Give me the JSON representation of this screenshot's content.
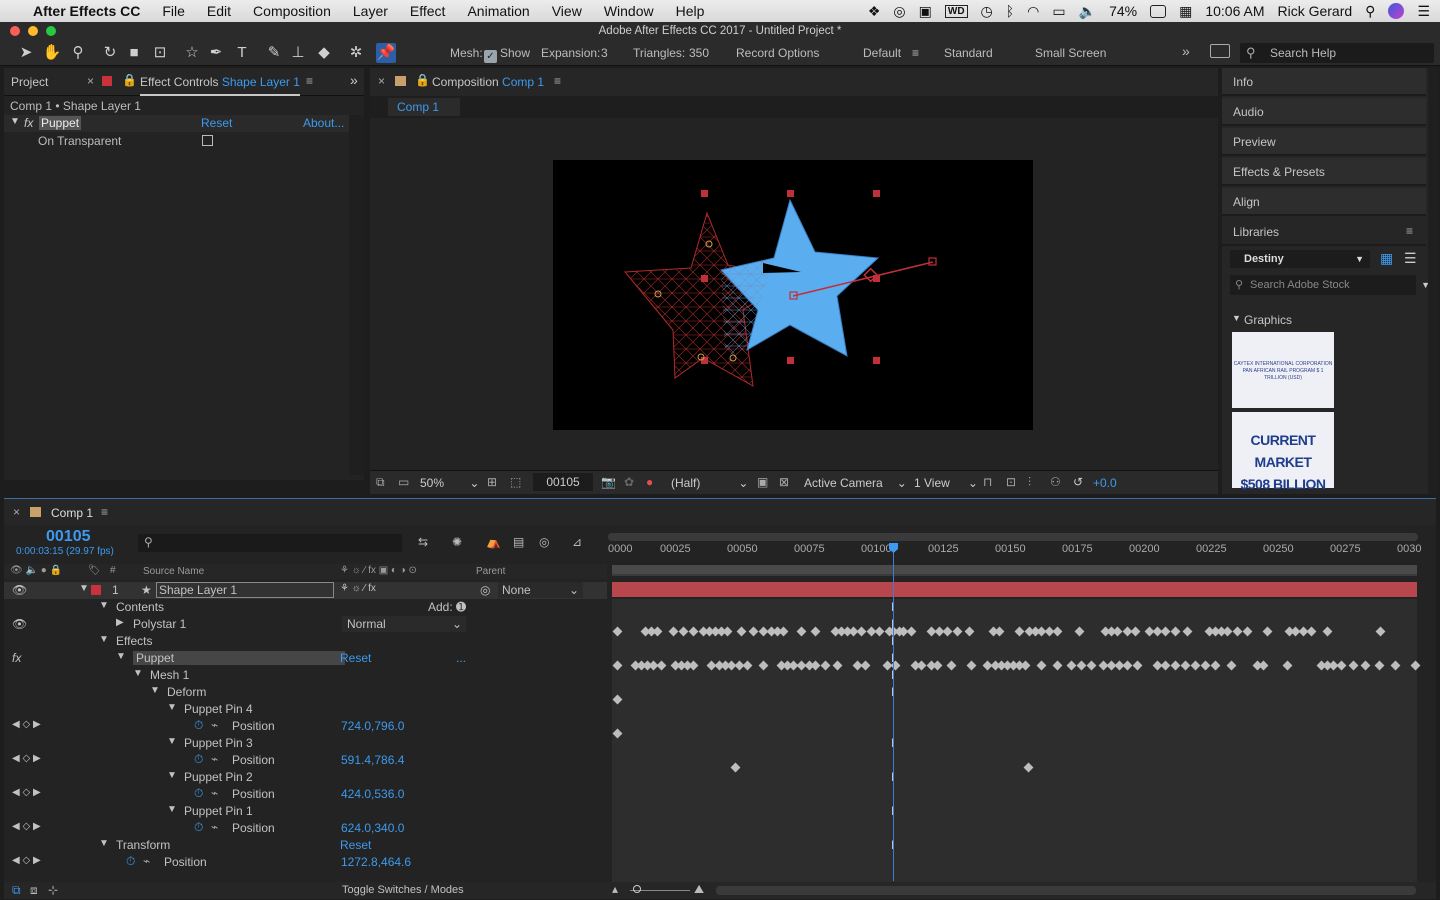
{
  "menubar": {
    "app_name": "After Effects CC",
    "items": [
      "File",
      "Edit",
      "Composition",
      "Layer",
      "Effect",
      "Animation",
      "View",
      "Window",
      "Help"
    ],
    "battery": "74%",
    "clock": "10:06 AM",
    "user": "Rick Gerard"
  },
  "window": {
    "title": "Adobe After Effects CC 2017 - Untitled Project *"
  },
  "toolbar": {
    "mesh_label": "Mesh:",
    "show_label": "Show",
    "expansion_label": "Expansion:",
    "expansion_value": "3",
    "triangles_label": "Triangles:",
    "triangles_value": "350",
    "record_options": "Record Options",
    "workspaces": [
      "Default",
      "Standard",
      "Small Screen"
    ],
    "search_help": "Search Help"
  },
  "effect_controls": {
    "tab_project": "Project",
    "tab_prefix": "Effect Controls",
    "tab_layer": "Shape Layer 1",
    "breadcrumb": "Comp 1 • Shape Layer 1",
    "effect_name": "Puppet",
    "reset": "Reset",
    "about": "About...",
    "on_transparent": "On Transparent"
  },
  "composition": {
    "tab_prefix": "Composition",
    "tab_comp": "Comp 1",
    "subtab": "Comp 1",
    "zoom": "50%",
    "timecode": "00105",
    "resolution": "(Half)",
    "camera": "Active Camera",
    "views": "1 View",
    "exposure": "+0.0"
  },
  "right_panel": {
    "items": [
      "Info",
      "Audio",
      "Preview",
      "Effects & Presets",
      "Align",
      "Libraries"
    ],
    "library_name": "Destiny",
    "search_stock": "Search Adobe Stock",
    "graphics_label": "Graphics",
    "thumb1_line1": "CAYTEX INTERNATIONAL CORPORATION",
    "thumb1_line2": "PAN AFRICAN RAIL PROGRAM $ 1 TRILLION (USD)",
    "thumb2_line1": "CURRENT MARKET",
    "thumb2_line2": "$508 BILLION"
  },
  "timeline": {
    "tab": "Comp 1",
    "timecode": "00105",
    "timecode_sub": "0:00:03:15 (29.97 fps)",
    "col_source": "Source Name",
    "col_parent": "Parent",
    "ruler": [
      "0000",
      "00025",
      "00050",
      "00075",
      "00100",
      "00125",
      "00150",
      "00175",
      "00200",
      "00225",
      "00250",
      "00275",
      "0030"
    ],
    "footer": "Toggle Switches / Modes",
    "layers": [
      {
        "name": "layer",
        "num": "1",
        "label": "Shape Layer 1",
        "parent": "None"
      },
      {
        "name": "contents",
        "label": "Contents",
        "extra": "Add:"
      },
      {
        "name": "polystar",
        "label": "Polystar 1",
        "extra": "Normal"
      },
      {
        "name": "effects",
        "label": "Effects"
      },
      {
        "name": "puppet",
        "label": "Puppet",
        "extra": "Reset",
        "extra2": "..."
      },
      {
        "name": "mesh",
        "label": "Mesh 1"
      },
      {
        "name": "deform",
        "label": "Deform"
      },
      {
        "name": "pin4",
        "label": "Puppet Pin 4"
      },
      {
        "name": "pin4-pos",
        "label": "Position",
        "value": "724.0,796.0"
      },
      {
        "name": "pin3",
        "label": "Puppet Pin 3"
      },
      {
        "name": "pin3-pos",
        "label": "Position",
        "value": "591.4,786.4"
      },
      {
        "name": "pin2",
        "label": "Puppet Pin 2"
      },
      {
        "name": "pin2-pos",
        "label": "Position",
        "value": "424.0,536.0"
      },
      {
        "name": "pin1",
        "label": "Puppet Pin 1"
      },
      {
        "name": "pin1-pos",
        "label": "Position",
        "value": "624.0,340.0"
      },
      {
        "name": "transform",
        "label": "Transform",
        "extra": "Reset"
      },
      {
        "name": "transform-pos",
        "label": "Position",
        "value": "1272.8,464.6"
      }
    ]
  },
  "colors": {
    "accent": "#3d9aee",
    "layer_red": "#c8323a",
    "star_blue": "#5aaef0",
    "mesh_red": "#b02a2a"
  }
}
